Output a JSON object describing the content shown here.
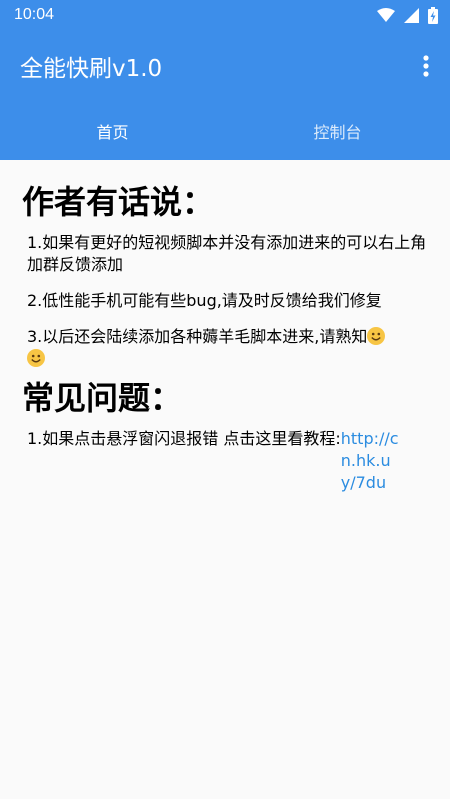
{
  "status_bar": {
    "time": "10:04",
    "icons": [
      "wifi-icon",
      "signal-icon",
      "battery-icon"
    ]
  },
  "app_bar": {
    "title": "全能快刷v1.0",
    "menu_icon": "more-vert-icon"
  },
  "tabs": [
    {
      "label": "首页",
      "selected": true
    },
    {
      "label": "控制台",
      "selected": false
    }
  ],
  "author": {
    "heading": "作者有话说：",
    "items": [
      "1.如果有更好的短视频脚本并没有添加进来的可以右上角加群反馈添加",
      "2.低性能手机可能有些bug,请及时反馈给我们修复",
      "3.以后还会陆续添加各种薅羊毛脚本进来,请熟知"
    ]
  },
  "faq": {
    "heading": "常见问题：",
    "item_text": "1.如果点击悬浮窗闪退报错 点击这里看教程:",
    "link_text": "http://cn.hk.uy/7du"
  },
  "colors": {
    "primary": "#3D8EEA",
    "background": "#FAFAFA",
    "link": "#2B8CE0"
  }
}
